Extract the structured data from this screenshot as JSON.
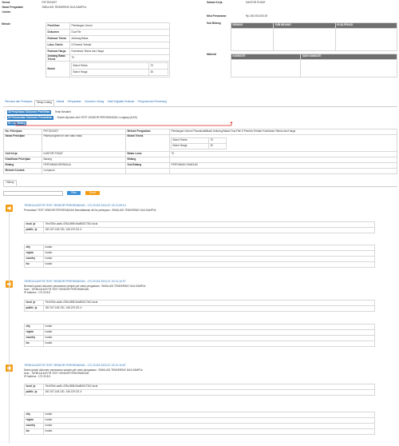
{
  "header_left": [
    {
      "label": "Nomor",
      "value": "PKT2024007"
    },
    {
      "label": "Nama Pengadaan",
      "value": "SIMULASI TENDERING DUA SAMPUL"
    },
    {
      "label": "Unsten",
      "value": ""
    }
  ],
  "header_right": [
    {
      "label": "Satuan Kerja",
      "value": "KANTOR PUSAT"
    },
    {
      "label": "Nilai Penawaran",
      "value": "Rp 200,000,000.00"
    },
    {
      "label": "Sub Bidang",
      "value": ""
    },
    {
      "label": "Material",
      "value": ""
    }
  ],
  "metode": {
    "label": "Metode",
    "rows": [
      {
        "k": "Pemilihan",
        "v": "Pelelangan Umum"
      },
      {
        "k": "Dokumen",
        "v": "Dua File"
      },
      {
        "k": "Evaluasi Teknis",
        "v": "Ambang Batas"
      },
      {
        "k": "Lulus Teknis",
        "v": "5 Peserta Terbaik"
      },
      {
        "k": "Evaluasi Harga",
        "v": "Kombinasi Teknis dan Harga"
      },
      {
        "k": "Ambang Batas Teknis",
        "v": "70"
      }
    ],
    "bobot": {
      "k": "Bobot",
      "rows": [
        {
          "k": "Bobot Teknis",
          "v": "70"
        },
        {
          "k": "Bobot Harga",
          "v": "30"
        }
      ]
    }
  },
  "sub_bidang_table": {
    "headers": [
      "BIDANG",
      "SUB BIDANG",
      "KUALIFIKASI"
    ]
  },
  "material_table": {
    "headers": [
      "KOMODITI",
      "SUB KOMODITI"
    ]
  },
  "tabs": [
    "Rencana dan Persiapan",
    "Tahap Lelang",
    "Jadwal",
    "Persyaratan",
    "Dokumen Lelang",
    "Hasil Kegiatan Evaluasi",
    "Pengumuman Pemenang"
  ],
  "active_tab": 1,
  "steps": [
    {
      "badge": "40 Penjelasan Dokumen Pemilihan",
      "text": "Telah Berakhir"
    },
    {
      "badge": "50 Pemasukan Dokumen Penawaran",
      "text": "Sudah diproses oleh TEST VENDOR PERORANGAN. Lengkap (4/4/3)"
    },
    {
      "badge": "81 Log Bidang",
      "text": ""
    }
  ],
  "detail": {
    "rows": [
      {
        "l1": "No. Pekerjaan",
        "v1": "PKT2024007",
        "l2": "Metode Pengadaan",
        "v2": "Pelelangan Umum/ Pascakualifikasi/ Ambang Batas/ Dua File/ 5 Peserta Terbaik/ Kombinasi Teknis dan Harga"
      },
      {
        "l1": "Nama Pekerjaan",
        "v1": "Paket program for oem atau mass",
        "l2": "Bobot Teknis",
        "v2": ""
      },
      {
        "l1": "Unit Kerja",
        "v1": "KANTOR PUSAT",
        "l2": "Batas Lulus",
        "v2": "70"
      },
      {
        "l1": "Klasifikasi Pekerjaan",
        "v1": "Barang",
        "l2": "Bidang",
        "v2": ""
      },
      {
        "l1": "Bidang",
        "v1": "PERTANIAN BERDAUA",
        "l2": "Sub Bidang",
        "v2": "PERTANIAN GANDUM"
      },
      {
        "l1": "Metode Kontrak",
        "v1": "Lumpsum",
        "l2": "",
        "v2": ""
      }
    ],
    "bobot": [
      {
        "k": "Bobot Teknis",
        "v": "70"
      },
      {
        "k": "Bobot Harga",
        "v": "30"
      }
    ]
  },
  "history_tab": "History",
  "filter_btn": "Filter",
  "reset_btn": "Reset",
  "logs": [
    {
      "title": "78780141420778 TEST VENDOR PERORANGAN - 172.20.8.5 2024-07-20 11:09:10",
      "lines": [
        "Pencairkan TEST VENDOR PERORANGAN Mendaftarkan diri ke pekerjaan : SIMULASI TENDERING DUA SAMPUL"
      ],
      "ip": [
        {
          "k": "local_ip",
          "v": "7fed784e-aa4b-478d-88f6-9da8f16172b2.local"
        },
        {
          "k": "public_ip",
          "v": "182.247.148.130, 146.129.211.4"
        }
      ],
      "geo": [
        {
          "k": "city",
          "v": "localw"
        },
        {
          "k": "region",
          "v": "localw"
        },
        {
          "k": "country",
          "v": "localw"
        },
        {
          "k": "loc",
          "v": "localw"
        }
      ]
    },
    {
      "title": "78780141420778 TEST VENDOR PERORANGAN - 172.20.8.5 2024-07-20 11:10:37",
      "lines": [
        "Berhasil upload dokumen penawaran (simple.pdf untuk pengadaan : SIMULASI TENDERING DUA SAMPUL",
        "User : 78780141420778 TEST VENDOR PERORANGAN",
        "IP Address : 172.20.8.5"
      ],
      "ip": [
        {
          "k": "local_ip",
          "v": "7fed784e-aa4b-478d-88f6-9da8f16172b2.local"
        },
        {
          "k": "public_ip",
          "v": "182.247.148.130, 146.129.211.4"
        }
      ],
      "geo": [
        {
          "k": "city",
          "v": "localw"
        },
        {
          "k": "region",
          "v": "localw"
        },
        {
          "k": "country",
          "v": "localw"
        },
        {
          "k": "loc",
          "v": "localw"
        }
      ]
    },
    {
      "title": "78780141420778 TEST VENDOR PERORANGAN - 172.20.8.5 2024-07-20 11:10:57",
      "lines": [
        "Mulai upload dokumen penawaran sample.pdf untuk pengadaan : SIMULASI TENDERING DUA SAMPUL",
        "User : 78780141420778 TEST VENDOR PERORANGAN",
        "IP Address : 172.20.8.5"
      ],
      "ip": [
        {
          "k": "local_ip",
          "v": "7fed784e-aa4b-478d-88f6-9da8f16172b2.local"
        },
        {
          "k": "public_ip",
          "v": "182.247.148.130, 146.129.211.4"
        }
      ],
      "geo": [
        {
          "k": "city",
          "v": "localw"
        },
        {
          "k": "region",
          "v": "localw"
        },
        {
          "k": "country",
          "v": "localw"
        },
        {
          "k": "loc",
          "v": "localw"
        }
      ]
    }
  ],
  "colors": {
    "accent": "#2b73b7",
    "bell": "#f39c12",
    "red_line": "#d9261c",
    "badge": "#2d7cc1"
  }
}
